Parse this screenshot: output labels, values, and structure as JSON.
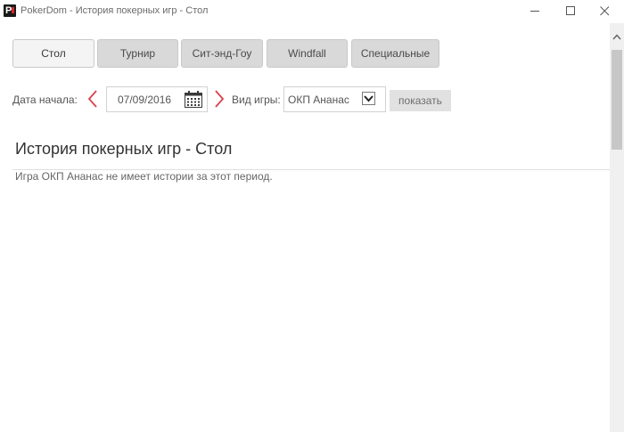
{
  "window": {
    "title": "PokerDom - История покерных игр - Стол",
    "logo_letter": "P"
  },
  "tabs": [
    {
      "label": "Стол",
      "active": true
    },
    {
      "label": "Турнир",
      "active": false
    },
    {
      "label": "Сит-энд-Гоу",
      "active": false
    },
    {
      "label": "Windfall",
      "active": false
    },
    {
      "label": "Специальные",
      "active": false
    }
  ],
  "filters": {
    "start_date_label": "Дата начала:",
    "start_date_value": "07/09/2016",
    "game_type_label": "Вид игры:",
    "game_type_value": "ОКП Ананас",
    "show_button_label": "показать"
  },
  "content": {
    "heading": "История покерных игр - Стол",
    "empty_message": "Игра ОКП Ананас не имеет истории за этот период."
  },
  "colors": {
    "arrow_red": "#d9414a",
    "logo_accent": "#d6262b",
    "tab_inactive": "#d9d9d9",
    "tab_active": "#f4f4f4"
  }
}
